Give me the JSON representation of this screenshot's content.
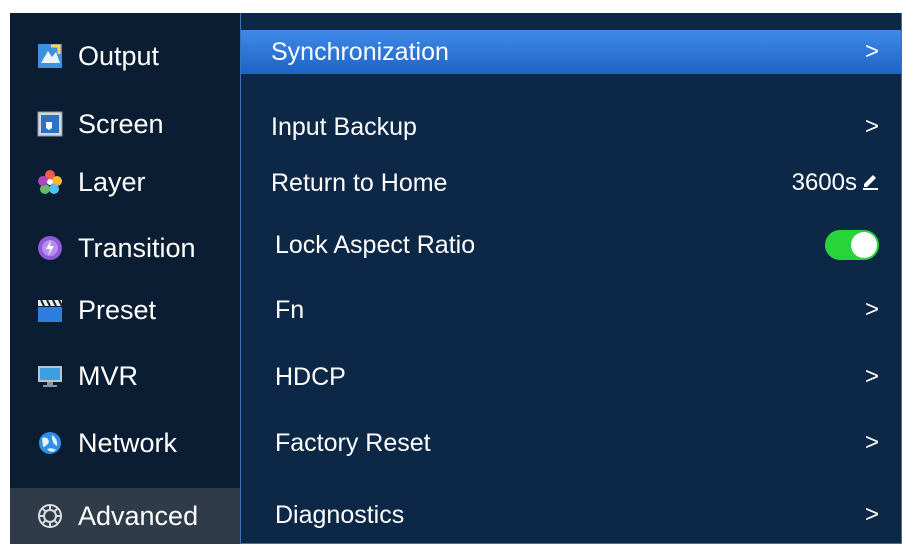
{
  "sidebar": {
    "items": [
      {
        "label": "Output",
        "icon": "output-icon"
      },
      {
        "label": "Screen",
        "icon": "screen-icon"
      },
      {
        "label": "Layer",
        "icon": "layer-icon"
      },
      {
        "label": "Transition",
        "icon": "transition-icon"
      },
      {
        "label": "Preset",
        "icon": "preset-icon"
      },
      {
        "label": "MVR",
        "icon": "mvr-icon"
      },
      {
        "label": "Network",
        "icon": "network-icon"
      },
      {
        "label": "Advanced",
        "icon": "advanced-icon"
      }
    ],
    "active": "Advanced"
  },
  "menu": {
    "items": [
      {
        "label": "Synchronization",
        "control": "chevron",
        "symbol": ">"
      },
      {
        "label": "Input Backup",
        "control": "chevron",
        "symbol": ">"
      },
      {
        "label": "Return to Home",
        "control": "value",
        "value": "3600s"
      },
      {
        "label": "Lock Aspect Ratio",
        "control": "toggle",
        "state": "on"
      },
      {
        "label": "Fn",
        "control": "chevron",
        "symbol": ">"
      },
      {
        "label": "HDCP",
        "control": "chevron",
        "symbol": ">"
      },
      {
        "label": "Factory Reset",
        "control": "chevron",
        "symbol": ">"
      },
      {
        "label": "Diagnostics",
        "control": "chevron",
        "symbol": ">"
      }
    ],
    "selected": "Synchronization"
  },
  "colors": {
    "selected_row": "#2e78dc",
    "toggle_on": "#29d43a",
    "panel_bg": "#0d2847",
    "sidebar_bg": "#0b1d33"
  }
}
